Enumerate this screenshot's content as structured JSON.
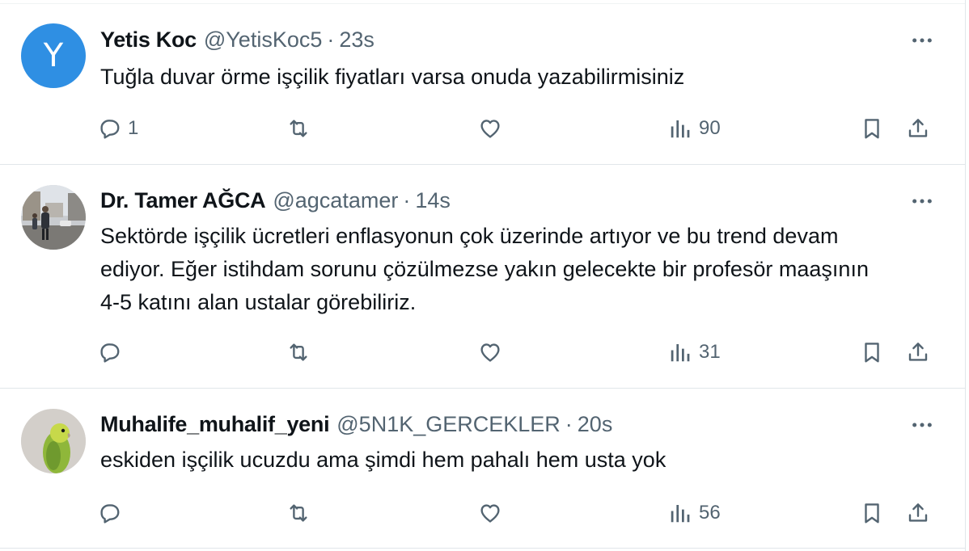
{
  "tweets": [
    {
      "name": "Yetis Koc",
      "handle": "@YetisKoc5",
      "separator": "·",
      "time": "23s",
      "avatar_letter": "Y",
      "text": "Tuğla duvar örme işçilik fiyatları varsa onuda yazabilirmisiniz",
      "reply_count": "1",
      "retweet_count": "",
      "like_count": "",
      "views": "90"
    },
    {
      "name": "Dr. Tamer AĞCA",
      "handle": "@agcatamer",
      "separator": "·",
      "time": "14s",
      "avatar_letter": "",
      "text": "Sektörde işçilik ücretleri enflasyonun çok üzerinde artıyor ve bu trend devam ediyor. Eğer istihdam sorunu çözülmezse yakın gelecekte bir profesör maaşının 4-5 katını alan ustalar görebiliriz.",
      "reply_count": "",
      "retweet_count": "",
      "like_count": "",
      "views": "31"
    },
    {
      "name": "Muhalife_muhalif_yeni",
      "handle": "@5N1K_GERCEKLER",
      "separator": "·",
      "time": "20s",
      "avatar_letter": "",
      "text": "eskiden işçilik ucuzdu ama şimdi hem pahalı hem usta yok",
      "reply_count": "",
      "retweet_count": "",
      "like_count": "",
      "views": "56"
    }
  ],
  "colors": {
    "text": "#0f1419",
    "secondary": "#536471",
    "divider": "#e1e6ea",
    "avatar_blue": "#2f8fe3"
  },
  "icons": [
    "reply-icon",
    "retweet-icon",
    "like-icon",
    "views-icon",
    "bookmark-icon",
    "share-icon",
    "more-icon"
  ]
}
